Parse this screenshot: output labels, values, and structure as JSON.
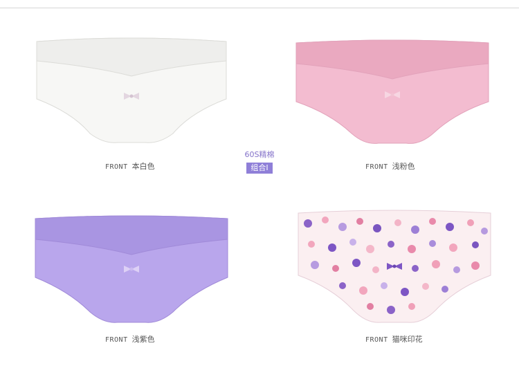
{
  "center_label": {
    "line1": "60S精棉",
    "tag": "组合I"
  },
  "products": [
    {
      "front_label": "FRONT",
      "color_name": "本白色",
      "fill": "#f7f7f5",
      "band": "#eeeeec",
      "bow": "#e3d6e0"
    },
    {
      "front_label": "FRONT",
      "color_name": "浅粉色",
      "fill": "#f3bcd0",
      "band": "#eaa9c0",
      "bow": "#f7d6e2"
    },
    {
      "front_label": "FRONT",
      "color_name": "浅紫色",
      "fill": "#b9a6ec",
      "band": "#a995e2",
      "bow": "#ddd0f6"
    },
    {
      "front_label": "FRONT",
      "color_name": "猫咪印花",
      "fill": "#fbeff1",
      "band": "#f5dde6",
      "bow": "#7d56c4"
    }
  ]
}
